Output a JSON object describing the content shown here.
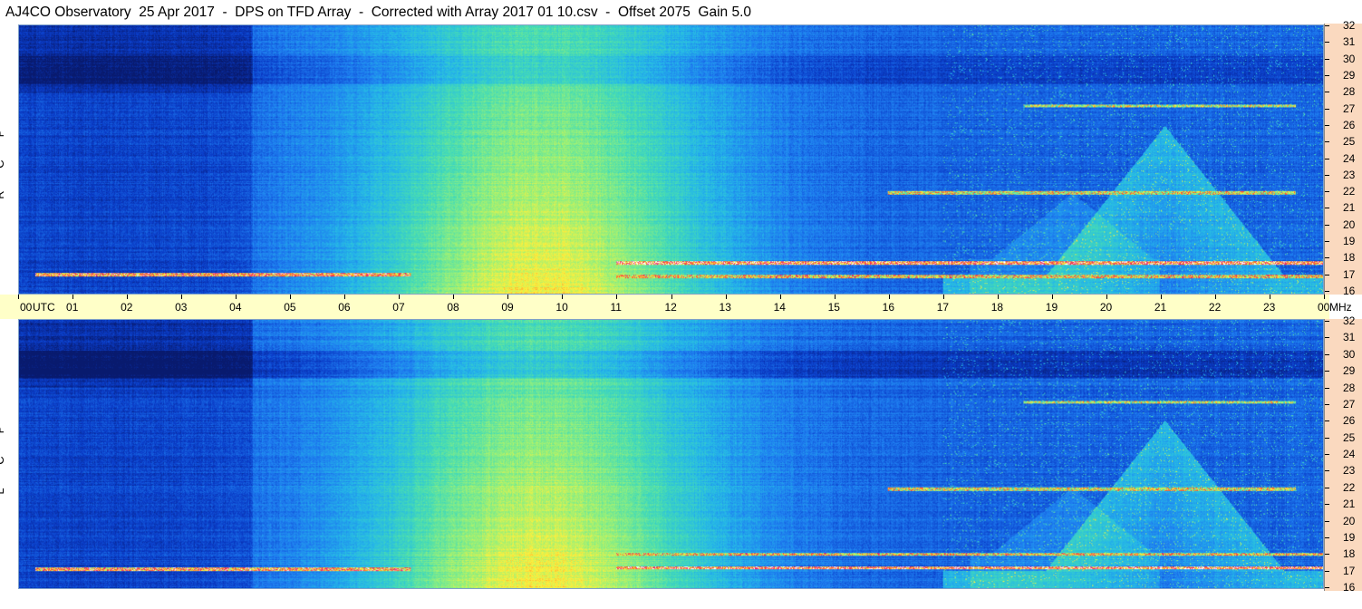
{
  "title": "AJ4CO Observatory  25 Apr 2017  -  DPS on TFD Array  -  Corrected with Array 2017 01 10.csv  -  Offset 2075  Gain 5.0",
  "panels": {
    "top_label": [
      "R",
      "C",
      "P"
    ],
    "bottom_label": [
      "L",
      "C",
      "P"
    ]
  },
  "time_axis": {
    "ticks": [
      "00",
      "01",
      "02",
      "03",
      "04",
      "05",
      "06",
      "07",
      "08",
      "09",
      "10",
      "11",
      "12",
      "13",
      "14",
      "15",
      "16",
      "17",
      "18",
      "19",
      "20",
      "21",
      "22",
      "23",
      "00"
    ],
    "unit_left": "UTC",
    "unit_right": "MHz"
  },
  "freq_axis": {
    "ticks": [
      "32",
      "31",
      "30",
      "29",
      "28",
      "27",
      "26",
      "25",
      "24",
      "23",
      "22",
      "21",
      "20",
      "19",
      "18",
      "17",
      "16"
    ]
  },
  "chart_data": {
    "type": "heatmap",
    "title": "AJ4CO Observatory  25 Apr 2017  -  DPS on TFD Array  -  Corrected with Array 2017 01 10.csv  -  Offset 2075  Gain 5.0",
    "xlabel": "UTC",
    "ylabel": "MHz",
    "xlim": [
      0,
      24
    ],
    "ylim": [
      16,
      32
    ],
    "series": [
      {
        "name": "RCP"
      },
      {
        "name": "LCP"
      }
    ],
    "colormap": [
      "#081a6e",
      "#0a3cc8",
      "#1e7cf0",
      "#25b8e8",
      "#46dcb4",
      "#96f07a",
      "#fff03c",
      "#ff6e28",
      "#e61e6e",
      "#ffffff"
    ]
  }
}
